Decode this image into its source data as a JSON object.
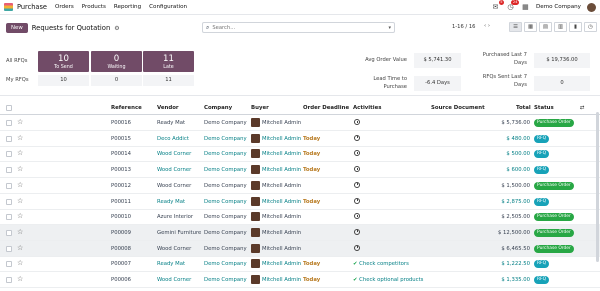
{
  "topnav": {
    "app_name": "Purchase",
    "menu": [
      "Orders",
      "Products",
      "Reporting",
      "Configuration"
    ],
    "chat_badge": "5",
    "activity_badge": "24",
    "company": "Demo Company"
  },
  "control": {
    "new_label": "New",
    "title": "Requests for Quotation",
    "search_placeholder": "Search...",
    "pager": "1-16 / 16"
  },
  "dashboard": {
    "all_rfqs_label": "All RFQs",
    "my_rfqs_label": "My RFQs",
    "tiles": [
      {
        "num": "10",
        "label": "To Send"
      },
      {
        "num": "0",
        "label": "Waiting"
      },
      {
        "num": "11",
        "label": "Late"
      }
    ],
    "my_values": [
      "10",
      "0",
      "11"
    ],
    "avg_order_label": "Avg Order Value",
    "avg_order_value": "$ 5,741.30",
    "purchased_last7_label_1": "Purchased Last 7",
    "purchased_last7_label_2": "Days",
    "purchased_last7_value": "$ 19,736.00",
    "lead_time_label_1": "Lead Time to",
    "lead_time_label_2": "Purchase",
    "lead_time_value": "-6.4 Days",
    "rfqs_sent_label_1": "RFQs Sent Last 7",
    "rfqs_sent_label_2": "Days",
    "rfqs_sent_value": "0"
  },
  "table": {
    "headers": {
      "reference": "Reference",
      "vendor": "Vendor",
      "company": "Company",
      "buyer": "Buyer",
      "deadline": "Order Deadline",
      "activities": "Activities",
      "source": "Source Document",
      "total": "Total",
      "status": "Status"
    },
    "rows": [
      {
        "ref": "P00016",
        "vendor": "Ready Mat",
        "company": "Demo Company",
        "buyer": "Mitchell Admin",
        "deadline": "",
        "activity": "",
        "total": "$ 5,736.00",
        "status": "Purchase Order"
      },
      {
        "ref": "P00015",
        "vendor": "Deco Addict",
        "company": "Demo Company",
        "buyer": "Mitchell Admin",
        "deadline": "Today",
        "activity": "",
        "total": "$ 480.00",
        "status": "RFQ"
      },
      {
        "ref": "P00014",
        "vendor": "Wood Corner",
        "company": "Demo Company",
        "buyer": "Mitchell Admin",
        "deadline": "Today",
        "activity": "",
        "total": "$ 500.00",
        "status": "RFQ"
      },
      {
        "ref": "P00013",
        "vendor": "Wood Corner",
        "company": "Demo Company",
        "buyer": "Mitchell Admin",
        "deadline": "Today",
        "activity": "",
        "total": "$ 600.00",
        "status": "RFQ"
      },
      {
        "ref": "P00012",
        "vendor": "Wood Corner",
        "company": "Demo Company",
        "buyer": "Mitchell Admin",
        "deadline": "",
        "activity": "",
        "total": "$ 1,500.00",
        "status": "Purchase Order"
      },
      {
        "ref": "P00011",
        "vendor": "Ready Mat",
        "company": "Demo Company",
        "buyer": "Mitchell Admin",
        "deadline": "Today",
        "activity": "",
        "total": "$ 2,875.00",
        "status": "RFQ"
      },
      {
        "ref": "P00010",
        "vendor": "Azure Interior",
        "company": "Demo Company",
        "buyer": "Mitchell Admin",
        "deadline": "",
        "activity": "",
        "total": "$ 2,505.00",
        "status": "Purchase Order"
      },
      {
        "ref": "P00009",
        "vendor": "Gemini Furniture",
        "company": "Demo Company",
        "buyer": "Mitchell Admin",
        "deadline": "",
        "activity": "",
        "total": "$ 12,500.00",
        "status": "Purchase Order"
      },
      {
        "ref": "P00008",
        "vendor": "Wood Corner",
        "company": "Demo Company",
        "buyer": "Mitchell Admin",
        "deadline": "",
        "activity": "",
        "total": "$ 6,465.50",
        "status": "Purchase Order"
      },
      {
        "ref": "P00007",
        "vendor": "Ready Mat",
        "company": "Demo Company",
        "buyer": "Mitchell Admin",
        "deadline": "Today",
        "activity": "Check competitors",
        "total": "$ 1,222.50",
        "status": "RFQ"
      },
      {
        "ref": "P00006",
        "vendor": "Wood Corner",
        "company": "Demo Company",
        "buyer": "Mitchell Admin",
        "deadline": "Today",
        "activity": "Check optional products",
        "total": "$ 1,335.00",
        "status": "RFQ"
      }
    ]
  },
  "colors": {
    "brand": "#714b67",
    "link": "#017e84",
    "po": "#28a745",
    "rfq": "#17a2b8",
    "today": "#b7791f"
  }
}
